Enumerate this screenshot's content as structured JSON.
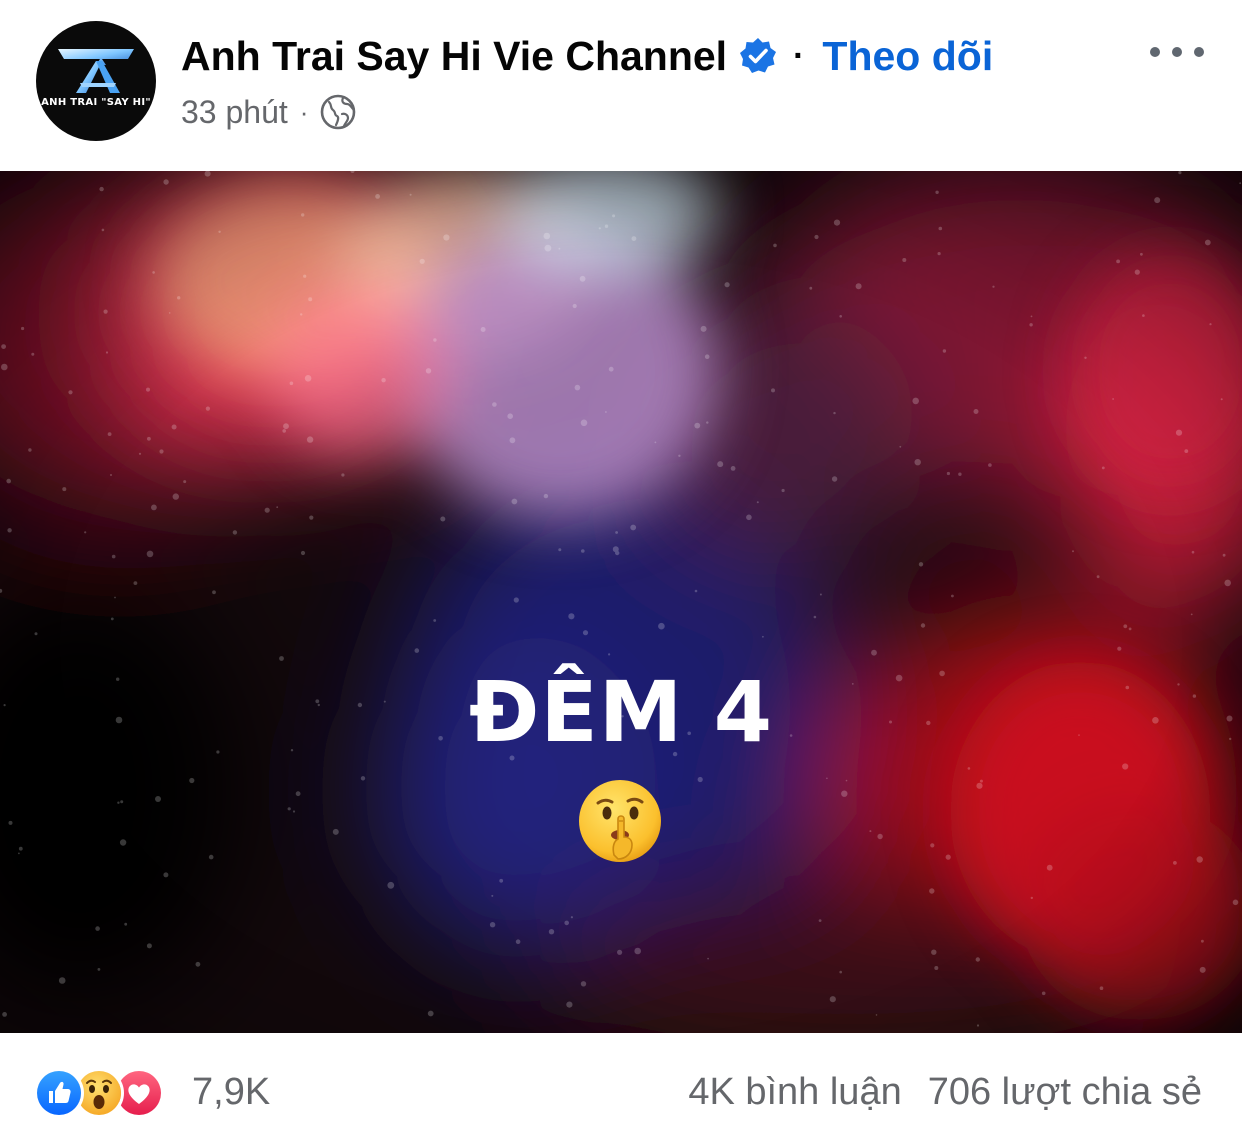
{
  "post": {
    "page_name": "Anh Trai Say Hi Vie Channel",
    "avatar_text": "ANH TRAI \"SAY HI\"",
    "separator": "·",
    "follow_label": "Theo dõi",
    "time": "33 phút",
    "meta_separator": "·",
    "privacy_icon": "globe-icon",
    "verified_icon": "verified-badge-icon",
    "more_icon": "more-options-icon"
  },
  "image": {
    "title": "ĐÊM 4",
    "emoji": "shushing-face-emoji"
  },
  "footer": {
    "reactions": [
      "like",
      "wow",
      "love"
    ],
    "reaction_count": "7,9K",
    "comments": "4K bình luận",
    "shares": "706 lượt chia sẻ"
  },
  "colors": {
    "accent": "#0a64d6",
    "text": "#050505",
    "secondary": "#65676b"
  }
}
